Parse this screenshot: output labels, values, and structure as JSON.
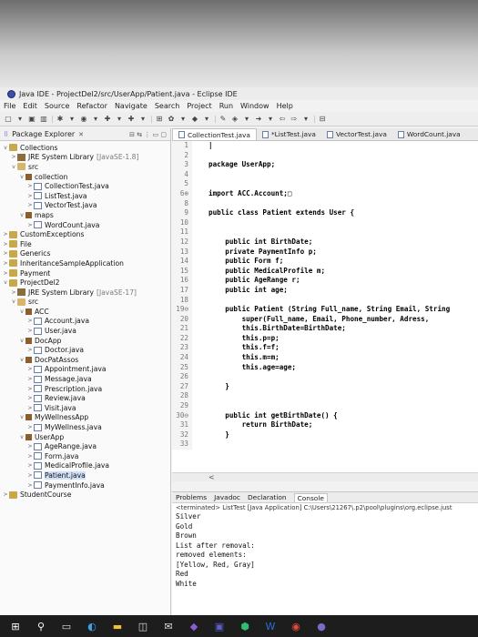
{
  "window": {
    "title": "Java IDE - ProjectDel2/src/UserApp/Patient.java - Eclipse IDE"
  },
  "menu": [
    "File",
    "Edit",
    "Source",
    "Refactor",
    "Navigate",
    "Search",
    "Project",
    "Run",
    "Window",
    "Help"
  ],
  "explorer": {
    "title": "Package Explorer",
    "tree": [
      {
        "tw": "v",
        "icon": "proj",
        "label": "Collections",
        "indent": 0
      },
      {
        "tw": ">",
        "icon": "lib",
        "label": "JRE System Library",
        "sub": "[JavaSE-1.8]",
        "indent": 1
      },
      {
        "tw": "v",
        "icon": "src",
        "label": "src",
        "indent": 1
      },
      {
        "tw": "v",
        "icon": "pkg",
        "label": "collection",
        "indent": 2
      },
      {
        "tw": ">",
        "icon": "java",
        "label": "CollectionTest.java",
        "indent": 3
      },
      {
        "tw": ">",
        "icon": "java",
        "label": "ListTest.java",
        "indent": 3
      },
      {
        "tw": ">",
        "icon": "java",
        "label": "VectorTest.java",
        "indent": 3
      },
      {
        "tw": "v",
        "icon": "pkg",
        "label": "maps",
        "indent": 2
      },
      {
        "tw": ">",
        "icon": "java",
        "label": "WordCount.java",
        "indent": 3
      },
      {
        "tw": ">",
        "icon": "proj",
        "label": "CustomExceptions",
        "indent": 0
      },
      {
        "tw": ">",
        "icon": "proj",
        "label": "File",
        "indent": 0
      },
      {
        "tw": ">",
        "icon": "proj",
        "label": "Generics",
        "indent": 0
      },
      {
        "tw": ">",
        "icon": "proj",
        "label": "InheritanceSampleApplication",
        "indent": 0
      },
      {
        "tw": ">",
        "icon": "proj",
        "label": "Payment",
        "indent": 0
      },
      {
        "tw": "v",
        "icon": "proj",
        "label": "ProjectDel2",
        "indent": 0
      },
      {
        "tw": ">",
        "icon": "lib",
        "label": "JRE System Library",
        "sub": "[JavaSE-17]",
        "indent": 1
      },
      {
        "tw": "v",
        "icon": "src",
        "label": "src",
        "indent": 1
      },
      {
        "tw": "v",
        "icon": "pkg",
        "label": "ACC",
        "indent": 2
      },
      {
        "tw": ">",
        "icon": "java",
        "label": "Account.java",
        "indent": 3
      },
      {
        "tw": ">",
        "icon": "java",
        "label": "User.java",
        "indent": 3
      },
      {
        "tw": "v",
        "icon": "pkg",
        "label": "DocApp",
        "indent": 2
      },
      {
        "tw": ">",
        "icon": "java",
        "label": "Doctor.java",
        "indent": 3
      },
      {
        "tw": "v",
        "icon": "pkg",
        "label": "DocPatAssos",
        "indent": 2
      },
      {
        "tw": ">",
        "icon": "java",
        "label": "Appointment.java",
        "indent": 3
      },
      {
        "tw": ">",
        "icon": "java",
        "label": "Message.java",
        "indent": 3
      },
      {
        "tw": ">",
        "icon": "java",
        "label": "Prescription.java",
        "indent": 3
      },
      {
        "tw": ">",
        "icon": "java",
        "label": "Review.java",
        "indent": 3
      },
      {
        "tw": ">",
        "icon": "java",
        "label": "Visit.java",
        "indent": 3
      },
      {
        "tw": "v",
        "icon": "pkg",
        "label": "MyWellnessApp",
        "indent": 2
      },
      {
        "tw": ">",
        "icon": "java",
        "label": "MyWellness.java",
        "indent": 3
      },
      {
        "tw": "v",
        "icon": "pkg",
        "label": "UserApp",
        "indent": 2
      },
      {
        "tw": ">",
        "icon": "java",
        "label": "AgeRange.java",
        "indent": 3
      },
      {
        "tw": ">",
        "icon": "java",
        "label": "Form.java",
        "indent": 3
      },
      {
        "tw": ">",
        "icon": "java",
        "label": "MedicalProfile.java",
        "indent": 3
      },
      {
        "tw": ">",
        "icon": "java",
        "label": "Patient.java",
        "indent": 3,
        "selected": true
      },
      {
        "tw": ">",
        "icon": "java",
        "label": "PaymentInfo.java",
        "indent": 3
      },
      {
        "tw": ">",
        "icon": "proj",
        "label": "StudentCourse",
        "indent": 0
      }
    ]
  },
  "editor": {
    "tabs": [
      {
        "label": "CollectionTest.java",
        "active": true
      },
      {
        "label": "*ListTest.java",
        "active": false
      },
      {
        "label": "VectorTest.java",
        "active": false
      },
      {
        "label": "WordCount.java",
        "active": false
      }
    ],
    "lines": [
      {
        "n": "1",
        "t": ""
      },
      {
        "n": "2",
        "t": ""
      },
      {
        "n": "3",
        "t": "package UserApp;"
      },
      {
        "n": "4",
        "t": ""
      },
      {
        "n": "5",
        "t": ""
      },
      {
        "n": "6⊕",
        "t": "import ACC.Account;□"
      },
      {
        "n": "8",
        "t": ""
      },
      {
        "n": "9",
        "t": "public class Patient extends User {"
      },
      {
        "n": "10",
        "t": ""
      },
      {
        "n": "11",
        "t": ""
      },
      {
        "n": "12",
        "t": "    public int BirthDate;"
      },
      {
        "n": "13",
        "t": "    private PaymentInfo p;"
      },
      {
        "n": "14",
        "t": "    public Form f;"
      },
      {
        "n": "15",
        "t": "    public MedicalProfile m;"
      },
      {
        "n": "16",
        "t": "    public AgeRange r;"
      },
      {
        "n": "17",
        "t": "    public int age;"
      },
      {
        "n": "18",
        "t": ""
      },
      {
        "n": "19⊖",
        "t": "    public Patient (String Full_name, String Email, String"
      },
      {
        "n": "20",
        "t": "        super(Full_name, Email, Phone_number, Adress,"
      },
      {
        "n": "21",
        "t": "        this.BirthDate=BirthDate;"
      },
      {
        "n": "22",
        "t": "        this.p=p;"
      },
      {
        "n": "23",
        "t": "        this.f=f;"
      },
      {
        "n": "24",
        "t": "        this.m=m;"
      },
      {
        "n": "25",
        "t": "        this.age=age;"
      },
      {
        "n": "26",
        "t": ""
      },
      {
        "n": "27",
        "t": "    }"
      },
      {
        "n": "28",
        "t": ""
      },
      {
        "n": "29",
        "t": ""
      },
      {
        "n": "30⊖",
        "t": "    public int getBirthDate() {"
      },
      {
        "n": "31",
        "t": "        return BirthDate;"
      },
      {
        "n": "32",
        "t": "    }"
      },
      {
        "n": "33",
        "t": ""
      }
    ],
    "scroll_left": "<"
  },
  "console": {
    "tabs": [
      "Problems",
      "Javadoc",
      "Declaration",
      "Console"
    ],
    "status": "<terminated> ListTest [Java Application] C:\\Users\\21267\\.p2\\pool\\plugins\\org.eclipse.just",
    "output": [
      "Silver",
      "Gold",
      "Brown",
      "List after removal:",
      "removed elements:",
      "[Yellow, Red, Gray]",
      "Red",
      "White"
    ]
  },
  "toolbar": [
    "▢",
    "▾",
    "▣",
    "▥",
    "|",
    "✱",
    "▾",
    "◉",
    "▾",
    "✚",
    "▾",
    "✚",
    "▾",
    "|",
    "⊞",
    "✿",
    "▾",
    "◆",
    "▾",
    "|",
    "✎",
    "◈",
    "▾",
    "➜",
    "▾",
    "⇦",
    "⇨",
    "▾",
    "|",
    "⊟"
  ]
}
